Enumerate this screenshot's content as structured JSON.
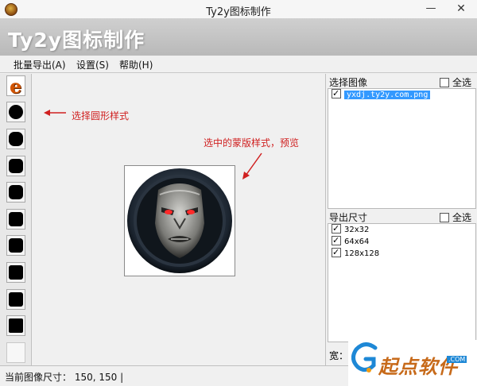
{
  "window": {
    "title": "Ty2y图标制作",
    "minimize": "—",
    "close": "✕"
  },
  "banner": {
    "title": "Ty2y图标制作"
  },
  "menu": [
    {
      "label": "批量导出(A)"
    },
    {
      "label": "设置(S)"
    },
    {
      "label": "帮助(H)"
    }
  ],
  "annotations": {
    "pick_shape": "选择圆形样式",
    "selected_preview": "选中的蒙版样式，预览"
  },
  "images_panel": {
    "header": "选择图像",
    "select_all": "全选",
    "items": [
      {
        "name": "yxdj.ty2y.com.png",
        "checked": true,
        "selected": true
      }
    ]
  },
  "sizes_panel": {
    "header": "导出尺寸",
    "select_all": "全选",
    "items": [
      {
        "label": "32x32",
        "checked": true
      },
      {
        "label": "64x64",
        "checked": true
      },
      {
        "label": "128x128",
        "checked": true
      }
    ]
  },
  "width_label": "宽：",
  "status": {
    "text": "当前图像尺寸： 150, 150  |"
  },
  "left_strip": {
    "first_icon": "e"
  },
  "watermark": {
    "brand": "起点软件",
    "url": ".COM"
  },
  "colors": {
    "annotation": "#d02020",
    "selection": "#3399ff",
    "brand": "#c76a1a"
  }
}
